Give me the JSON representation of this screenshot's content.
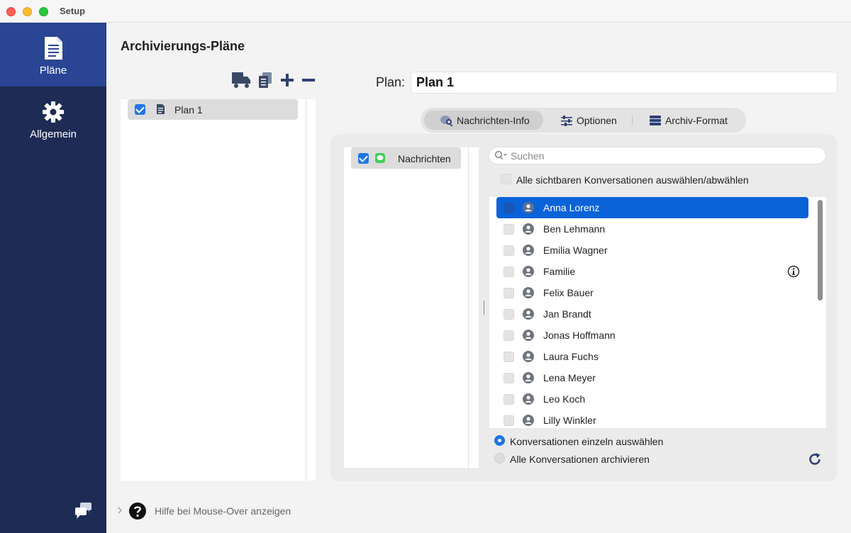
{
  "window": {
    "title": "Setup"
  },
  "sidebar": {
    "items": [
      {
        "label": "Pläne",
        "icon": "document-icon",
        "active": true
      },
      {
        "label": "Allgemein",
        "icon": "gear-icon",
        "active": false
      }
    ],
    "bottom_icon": "chat-bubbles-icon"
  },
  "main": {
    "title": "Archivierungs-Pläne",
    "toolbar": [
      "truck-icon",
      "copy-icon",
      "plus-icon",
      "minus-icon"
    ],
    "plans": [
      {
        "label": "Plan 1",
        "checked": true
      }
    ]
  },
  "plan": {
    "label": "Plan:",
    "name": "Plan 1"
  },
  "tabs": [
    {
      "label": "Nachrichten-Info",
      "icon": "message-search-icon",
      "active": true
    },
    {
      "label": "Optionen",
      "icon": "sliders-icon",
      "active": false
    },
    {
      "label": "Archiv-Format",
      "icon": "stack-icon",
      "active": false
    }
  ],
  "sources": [
    {
      "label": "Nachrichten",
      "checked": true
    }
  ],
  "search": {
    "placeholder": "Suchen"
  },
  "select_all_label": "Alle sichtbaren Konversationen auswählen/abwählen",
  "conversations": [
    {
      "name": "Anna Lorenz",
      "selected": true
    },
    {
      "name": "Ben Lehmann"
    },
    {
      "name": "Emilia Wagner"
    },
    {
      "name": "Familie",
      "info": true
    },
    {
      "name": "Felix Bauer"
    },
    {
      "name": "Jan Brandt"
    },
    {
      "name": "Jonas Hoffmann"
    },
    {
      "name": "Laura Fuchs"
    },
    {
      "name": "Lena Meyer"
    },
    {
      "name": "Leo Koch"
    },
    {
      "name": "Lilly Winkler"
    }
  ],
  "radio": {
    "single": "Konversationen einzeln auswählen",
    "all": "Alle Konversationen archivieren"
  },
  "footer": {
    "help": "Hilfe bei Mouse-Over anzeigen"
  },
  "colors": {
    "sidebar": "#1d2b55",
    "sidebar_active": "#2a4593",
    "accent": "#1f74e7",
    "selection": "#0b63d8"
  }
}
